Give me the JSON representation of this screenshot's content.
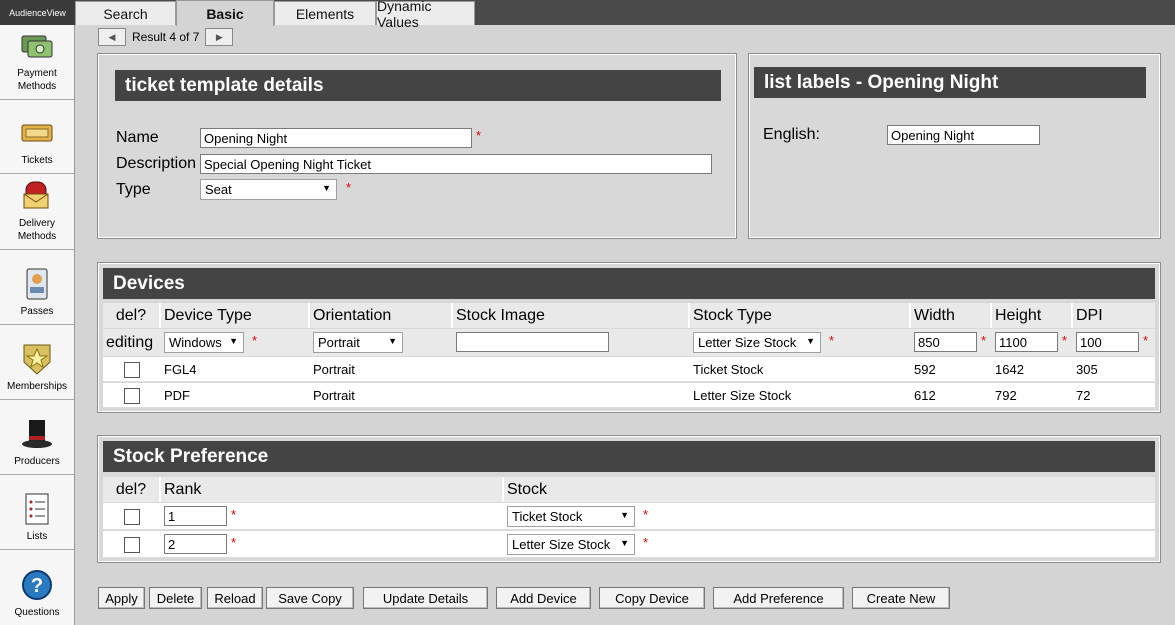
{
  "app": {
    "brand": "AudienceView"
  },
  "tabs": [
    {
      "label": "Search"
    },
    {
      "label": "Basic"
    },
    {
      "label": "Elements"
    },
    {
      "label": "Dynamic Values"
    }
  ],
  "nav": [
    {
      "label_line1": "Payment",
      "label_line2": "Methods",
      "icon": "payment-icon"
    },
    {
      "label_line1": "Tickets",
      "label_line2": "",
      "icon": "ticket-icon"
    },
    {
      "label_line1": "Delivery",
      "label_line2": "Methods",
      "icon": "mailbox-icon"
    },
    {
      "label_line1": "Passes",
      "label_line2": "",
      "icon": "pass-icon"
    },
    {
      "label_line1": "Memberships",
      "label_line2": "",
      "icon": "star-badge-icon"
    },
    {
      "label_line1": "Producers",
      "label_line2": "",
      "icon": "top-hat-icon"
    },
    {
      "label_line1": "Lists",
      "label_line2": "",
      "icon": "list-icon"
    },
    {
      "label_line1": "Questions",
      "label_line2": "",
      "icon": "question-icon"
    }
  ],
  "pager": {
    "text": "Result 4 of 7"
  },
  "details": {
    "title": "ticket template details",
    "name_label": "Name",
    "name_value": "Opening Night",
    "description_label": "Description",
    "description_value": "Special Opening Night Ticket",
    "type_label": "Type",
    "type_value": "Seat",
    "required_mark": "*"
  },
  "list_labels": {
    "title": "list labels - Opening Night",
    "english_label": "English:",
    "english_value": "Opening Night"
  },
  "devices": {
    "title": "Devices",
    "columns": [
      "del?",
      "Device Type",
      "Orientation",
      "Stock Image",
      "Stock Type",
      "Width",
      "Height",
      "DPI"
    ],
    "editing": {
      "label": "editing",
      "device_type": "Windows",
      "orientation": "Portrait",
      "stock_image": "",
      "stock_type": "Letter Size Stock",
      "width": "850",
      "height": "1100",
      "dpi": "100"
    },
    "rows": [
      {
        "device_type": "FGL4",
        "orientation": "Portrait",
        "stock_image": "",
        "stock_type": "Ticket Stock",
        "width": "592",
        "height": "1642",
        "dpi": "305"
      },
      {
        "device_type": "PDF",
        "orientation": "Portrait",
        "stock_image": "",
        "stock_type": "Letter Size Stock",
        "width": "612",
        "height": "792",
        "dpi": "72"
      }
    ]
  },
  "stock_pref": {
    "title": "Stock Preference",
    "columns": [
      "del?",
      "Rank",
      "Stock"
    ],
    "rows": [
      {
        "rank": "1",
        "stock": "Ticket Stock"
      },
      {
        "rank": "2",
        "stock": "Letter Size Stock"
      }
    ]
  },
  "buttons": {
    "apply": "Apply",
    "delete": "Delete",
    "reload": "Reload",
    "save_copy": "Save Copy",
    "update_details": "Update Details",
    "add_device": "Add Device",
    "copy_device": "Copy Device",
    "add_preference": "Add Preference",
    "create_new": "Create New"
  },
  "colors": {
    "header_bg": "#444444",
    "required": "#dd0000",
    "page_bg": "#d4d4d4"
  }
}
